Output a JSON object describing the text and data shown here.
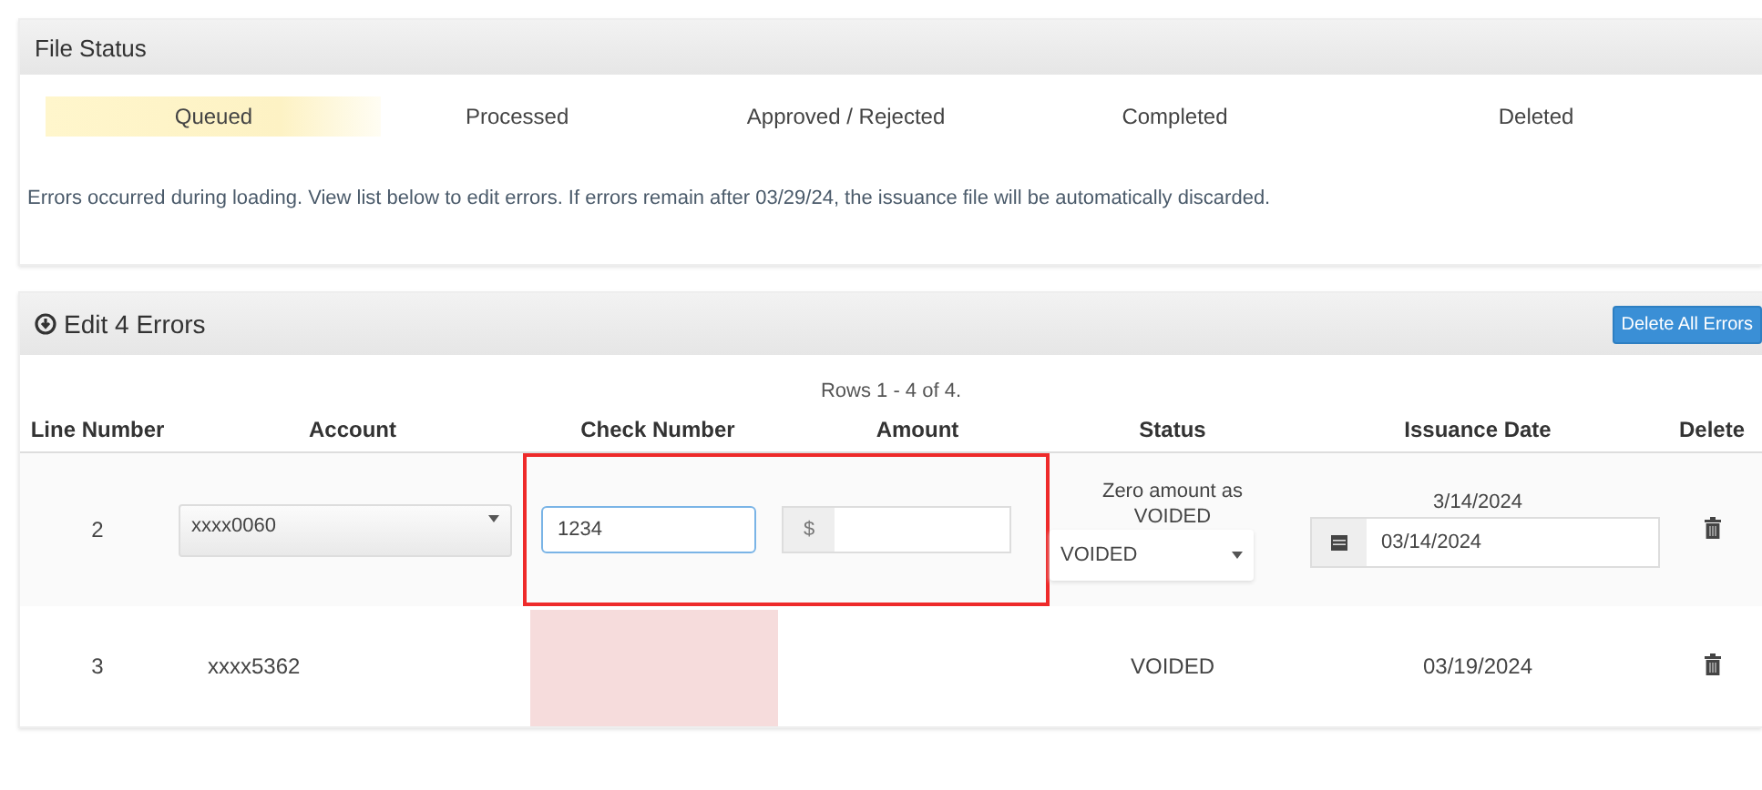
{
  "file_status": {
    "title": "File Status",
    "steps": [
      {
        "label": "Queued",
        "selected": true
      },
      {
        "label": "Processed",
        "selected": false
      },
      {
        "label": "Approved / Rejected",
        "selected": false
      },
      {
        "label": "Completed",
        "selected": false
      },
      {
        "label": "Deleted",
        "selected": false
      }
    ],
    "message": "Errors occurred during loading. View list below to edit errors. If errors remain after 03/29/24, the issuance file will be automatically discarded."
  },
  "errors_panel": {
    "title": "Edit 4 Errors",
    "button": "Delete All Errors",
    "rows_info": "Rows 1 - 4 of 4.",
    "columns": [
      "Line Number",
      "Account",
      "Check Number",
      "Amount",
      "Status",
      "Issuance Date",
      "Delete"
    ],
    "rows": [
      {
        "kind": "editable",
        "line": "2",
        "account": "xxxx0060",
        "check_number": "1234",
        "amount_prefix": "$",
        "status_note": "Zero amount as VOIDED",
        "status_value": "VOIDED",
        "date_label": "3/14/2024",
        "date_value": "03/14/2024",
        "highlighted": true
      },
      {
        "kind": "static",
        "line": "3",
        "account": "xxxx5362",
        "status": "VOIDED",
        "date": "03/19/2024",
        "check_error": true
      }
    ]
  }
}
